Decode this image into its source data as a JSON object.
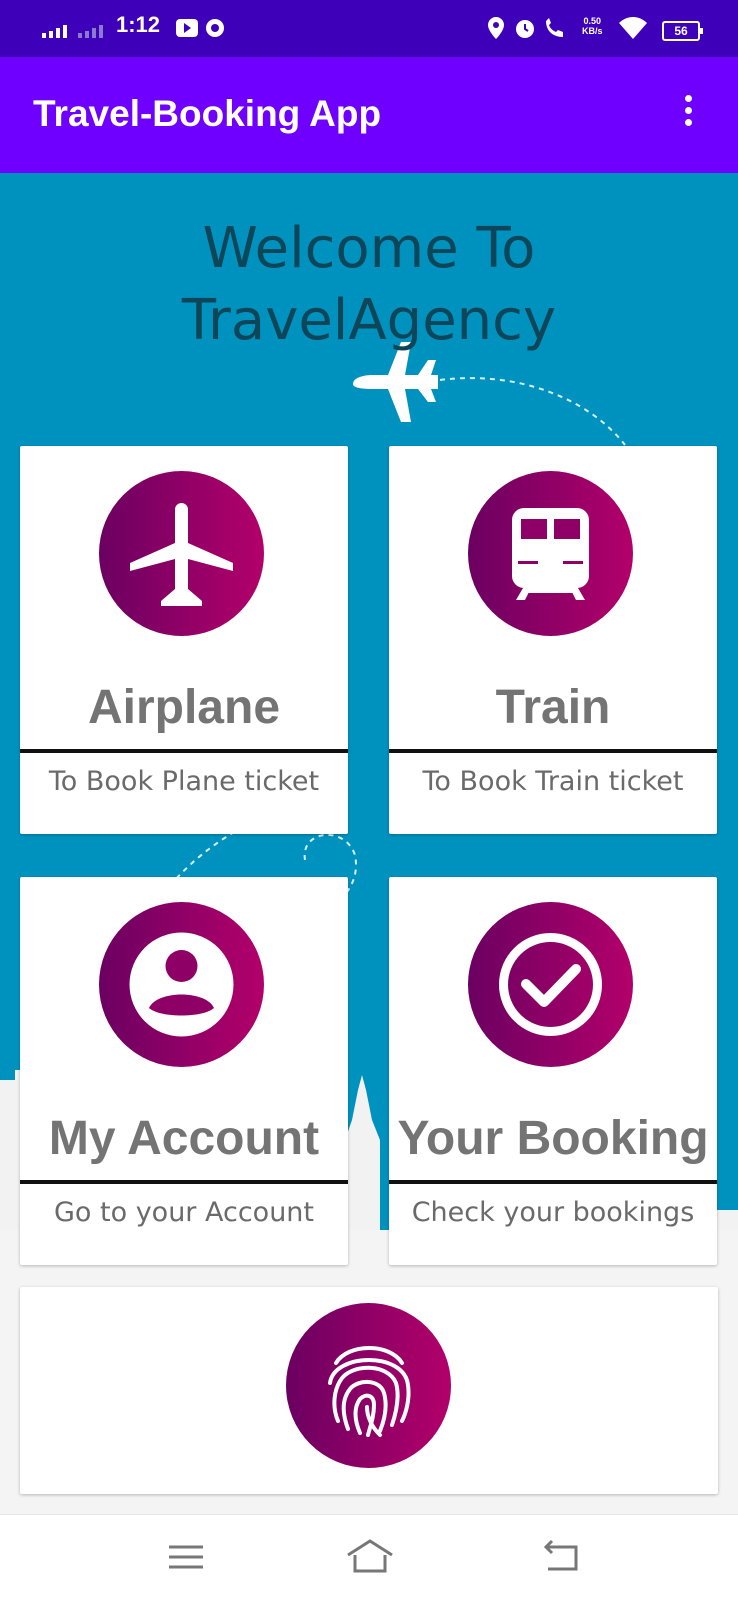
{
  "status_bar": {
    "time": "1:12",
    "network_speed": "0.50",
    "network_unit": "KB/s",
    "battery": "56",
    "icons": [
      "signal-icon",
      "signal-weak-icon",
      "youtube-icon",
      "chrome-icon",
      "location-icon",
      "alarm-icon",
      "wifi-calling-icon",
      "wifi-icon",
      "battery-icon"
    ]
  },
  "app_bar": {
    "title": "Travel-Booking App",
    "menu_icon": "more-vert-icon"
  },
  "welcome": {
    "line1": "Welcome To",
    "line2": "TravelAgency"
  },
  "cards": [
    {
      "title": "Airplane",
      "subtitle": "To Book Plane ticket",
      "icon": "airplane-icon"
    },
    {
      "title": "Train",
      "subtitle": "To Book Train ticket",
      "icon": "train-icon"
    },
    {
      "title": "My Account",
      "subtitle": "Go to your Account",
      "icon": "account-icon"
    },
    {
      "title": "Your Booking",
      "subtitle": "Check your bookings",
      "icon": "check-circle-icon"
    }
  ],
  "fingerprint_card": {
    "icon": "fingerprint-icon"
  },
  "nav_bar": {
    "icons": [
      "menu-icon",
      "home-icon",
      "back-icon"
    ]
  },
  "colors": {
    "status_bar": "#3f00b9",
    "app_bar": "#6f00ff",
    "background": "#0092bf",
    "circle_gradient_start": "#6b0061",
    "circle_gradient_end": "#b3006a"
  }
}
